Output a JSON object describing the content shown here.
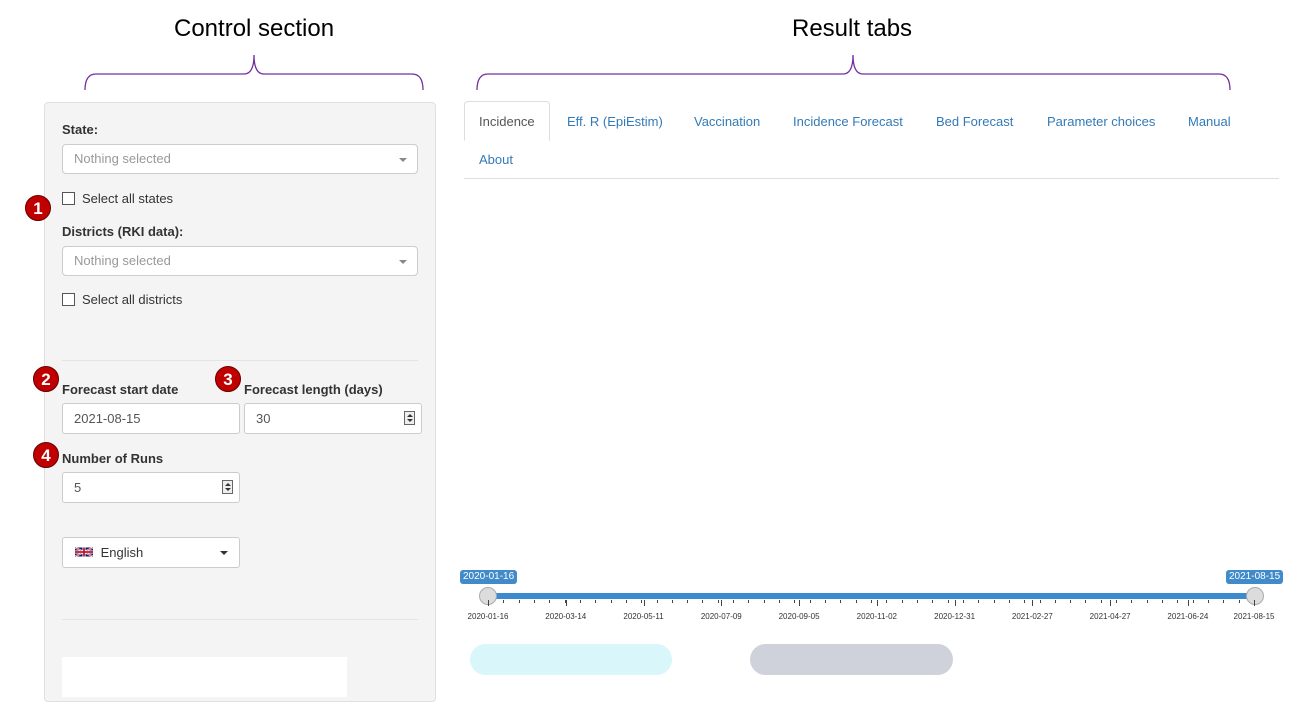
{
  "headings": {
    "control": "Control section",
    "results": "Result tabs"
  },
  "controls": {
    "state_label": "State:",
    "state_placeholder": "Nothing selected",
    "select_all_states": "Select all states",
    "districts_label": "Districts (RKI data):",
    "districts_placeholder": "Nothing selected",
    "select_all_districts": "Select all districts",
    "forecast_start_label": "Forecast start date",
    "forecast_start_value": "2021-08-15",
    "forecast_length_label": "Forecast length (days)",
    "forecast_length_value": "30",
    "runs_label": "Number of Runs",
    "runs_value": "5",
    "language": "English"
  },
  "badges": [
    "1",
    "2",
    "3",
    "4"
  ],
  "tabs": [
    "Incidence",
    "Eff. R (EpiEstim)",
    "Vaccination",
    "Incidence Forecast",
    "Bed Forecast",
    "Parameter choices",
    "Manual",
    "About"
  ],
  "slider": {
    "from": "2020-01-16",
    "to": "2021-08-15",
    "ticks": [
      "2020-01-16",
      "2020-03-14",
      "2020-05-11",
      "2020-07-09",
      "2020-09-05",
      "2020-11-02",
      "2020-12-31",
      "2021-02-27",
      "2021-04-27",
      "2021-06-24",
      "2021-08-15"
    ]
  },
  "colors": {
    "badge": "#c00000",
    "brace": "#7030a0",
    "slider": "#3c8ad0",
    "link": "#337ab7"
  },
  "icons": {
    "flag": "uk-flag-icon",
    "dropdown": "chevron-down-icon"
  }
}
